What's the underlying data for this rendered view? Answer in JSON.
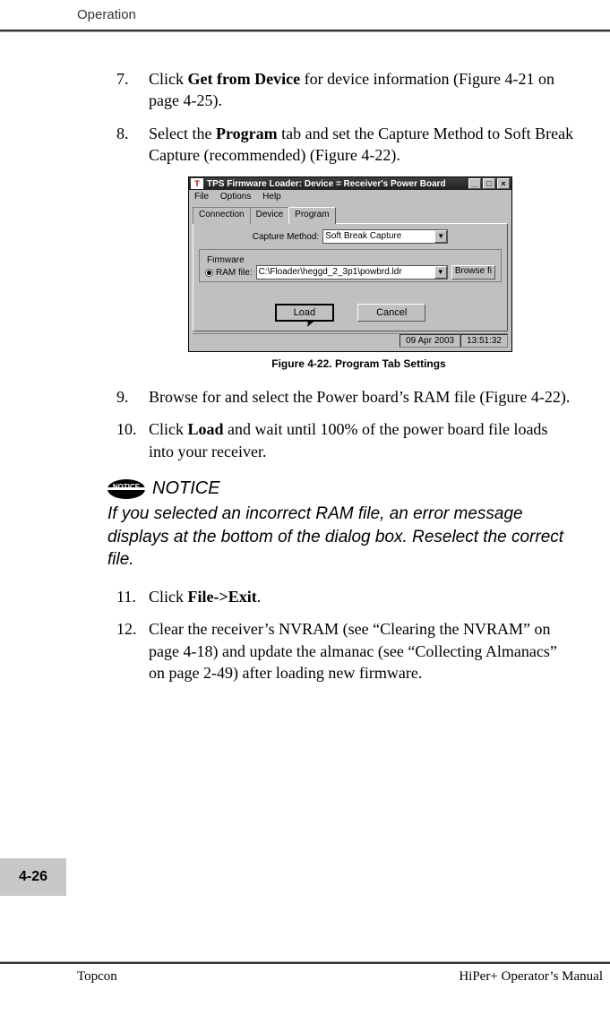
{
  "header": {
    "section": "Operation"
  },
  "steps": {
    "s7": {
      "num": "7.",
      "pre": "Click ",
      "bold": "Get from Device",
      "post": " for device information (Figure 4-21 on page 4-25)."
    },
    "s8": {
      "num": "8.",
      "pre": "Select the ",
      "bold": "Program",
      "post": " tab and set the Capture Method to Soft Break Capture (recommended) (Figure 4-22)."
    },
    "s9": {
      "num": "9.",
      "text": "Browse for and select the Power board’s RAM file (Figure 4-22)."
    },
    "s10": {
      "num": "10.",
      "pre": "Click ",
      "bold": "Load",
      "post": " and wait until 100% of the power board file loads into your receiver."
    },
    "s11": {
      "num": "11.",
      "pre": "Click ",
      "bold": "File->Exit",
      "post": "."
    },
    "s12": {
      "num": "12.",
      "text": "Clear the receiver’s NVRAM (see “Clearing the NVRAM” on page 4-18) and update the almanac (see “Collecting Almanacs” on page 2-49) after loading new firmware."
    }
  },
  "figure": {
    "caption": "Figure 4-22. Program Tab Settings",
    "dialog": {
      "titleIcon": "T",
      "title": "TPS Firmware Loader:  Device = Receiver's Power Board",
      "minLabel": "_",
      "maxLabel": "□",
      "closeLabel": "×",
      "menu": {
        "file": "File",
        "options": "Options",
        "help": "Help"
      },
      "tabs": {
        "connection": "Connection",
        "device": "Device",
        "program": "Program"
      },
      "captureLabel": "Capture Method:",
      "captureValue": "Soft Break Capture",
      "firmwareLabel": "Firmware",
      "ramLabel": "RAM file:",
      "ramPath": "C:\\Floader\\heggd_2_3p1\\powbrd.ldr",
      "browseLabel": "Browse fi",
      "loadLabel": "Load",
      "cancelLabel": "Cancel",
      "statusDate": "09 Apr 2003",
      "statusTime": "13:51:32"
    }
  },
  "notice": {
    "iconText": "NOTICE",
    "title": "NOTICE",
    "body": "If you selected an incorrect RAM file, an error message displays at the bottom of the dialog box. Reselect the correct file."
  },
  "pageNumber": "4-26",
  "footer": {
    "left": "Topcon",
    "right": "HiPer+ Operator’s Manual"
  }
}
